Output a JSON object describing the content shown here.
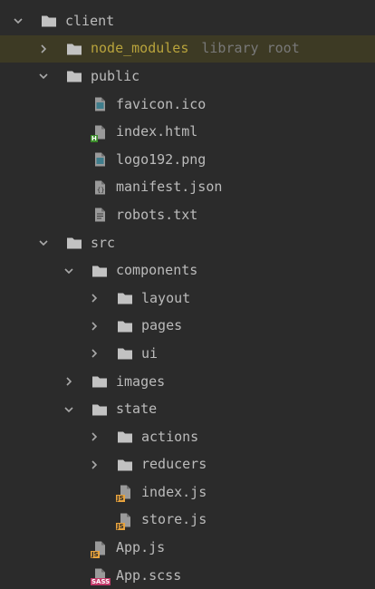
{
  "tree": [
    {
      "label": "client",
      "hint": "",
      "depth": 0,
      "kind": "folder",
      "expand": "open",
      "excluded": false
    },
    {
      "label": "node_modules",
      "hint": "library root",
      "depth": 1,
      "kind": "folder",
      "expand": "closed",
      "excluded": true
    },
    {
      "label": "public",
      "hint": "",
      "depth": 1,
      "kind": "folder",
      "expand": "open",
      "excluded": false
    },
    {
      "label": "favicon.ico",
      "hint": "",
      "depth": 2,
      "kind": "image",
      "expand": "none",
      "excluded": false
    },
    {
      "label": "index.html",
      "hint": "",
      "depth": 2,
      "kind": "html",
      "expand": "none",
      "excluded": false
    },
    {
      "label": "logo192.png",
      "hint": "",
      "depth": 2,
      "kind": "image",
      "expand": "none",
      "excluded": false
    },
    {
      "label": "manifest.json",
      "hint": "",
      "depth": 2,
      "kind": "json",
      "expand": "none",
      "excluded": false
    },
    {
      "label": "robots.txt",
      "hint": "",
      "depth": 2,
      "kind": "text",
      "expand": "none",
      "excluded": false
    },
    {
      "label": "src",
      "hint": "",
      "depth": 1,
      "kind": "folder",
      "expand": "open",
      "excluded": false
    },
    {
      "label": "components",
      "hint": "",
      "depth": 2,
      "kind": "folder",
      "expand": "open",
      "excluded": false
    },
    {
      "label": "layout",
      "hint": "",
      "depth": 3,
      "kind": "folder",
      "expand": "closed",
      "excluded": false
    },
    {
      "label": "pages",
      "hint": "",
      "depth": 3,
      "kind": "folder",
      "expand": "closed",
      "excluded": false
    },
    {
      "label": "ui",
      "hint": "",
      "depth": 3,
      "kind": "folder",
      "expand": "closed",
      "excluded": false
    },
    {
      "label": "images",
      "hint": "",
      "depth": 2,
      "kind": "folder",
      "expand": "closed",
      "excluded": false
    },
    {
      "label": "state",
      "hint": "",
      "depth": 2,
      "kind": "folder",
      "expand": "open",
      "excluded": false
    },
    {
      "label": "actions",
      "hint": "",
      "depth": 3,
      "kind": "folder",
      "expand": "closed",
      "excluded": false
    },
    {
      "label": "reducers",
      "hint": "",
      "depth": 3,
      "kind": "folder",
      "expand": "closed",
      "excluded": false
    },
    {
      "label": "index.js",
      "hint": "",
      "depth": 3,
      "kind": "js",
      "expand": "none",
      "excluded": false
    },
    {
      "label": "store.js",
      "hint": "",
      "depth": 3,
      "kind": "js",
      "expand": "none",
      "excluded": false
    },
    {
      "label": "App.js",
      "hint": "",
      "depth": 2,
      "kind": "js",
      "expand": "none",
      "excluded": false
    },
    {
      "label": "App.scss",
      "hint": "",
      "depth": 2,
      "kind": "sass",
      "expand": "none",
      "excluded": false
    }
  ],
  "colors": {
    "background": "#2b2b2b",
    "excluded_row": "#3d3a24",
    "excluded_text": "#b8a33c",
    "text": "#bbbbbb",
    "hint": "#787878",
    "folder": "#c2c2c2",
    "js_badge": "#e8a33d",
    "html_badge": "#3b8c2a",
    "sass_badge": "#c43a6a"
  },
  "icon_names": {
    "folder": "folder-icon",
    "image": "image-file-icon",
    "html": "html-file-icon",
    "json": "json-file-icon",
    "text": "text-file-icon",
    "js": "javascript-file-icon",
    "sass": "sass-file-icon"
  }
}
